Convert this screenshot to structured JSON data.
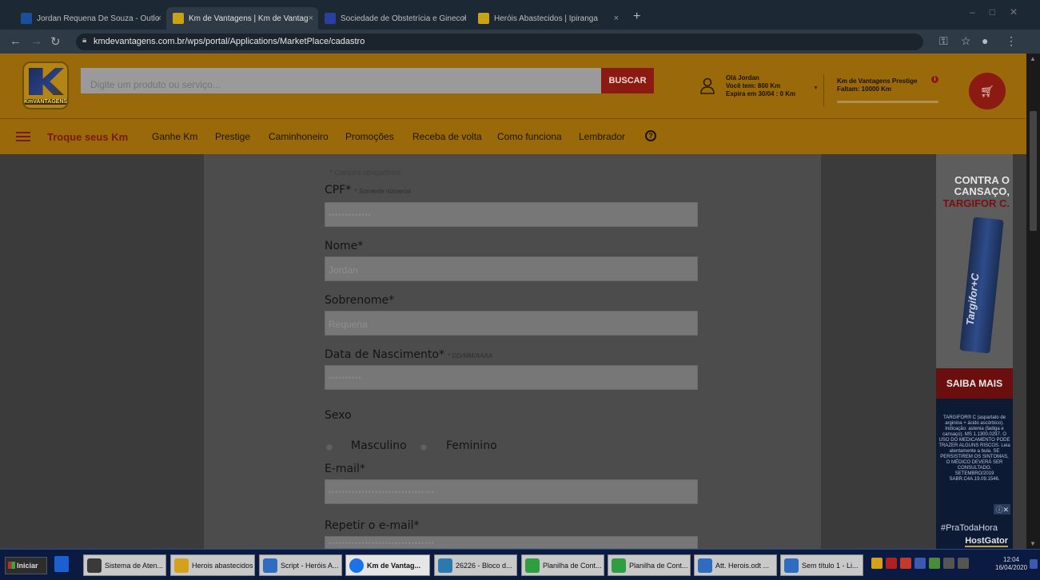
{
  "browser": {
    "tabs": [
      {
        "label": "Jordan Requena De Souza - Outlo",
        "favicon_color": "#1b4f9c",
        "active": false
      },
      {
        "label": "Km de Vantagens | Km de Vantag",
        "favicon_color": "#c8a318",
        "active": true
      },
      {
        "label": "Sociedade de Obstetrícia e Ginecol",
        "favicon_color": "#2b3fa0",
        "active": false
      },
      {
        "label": "Heróis Abastecidos | Ipiranga",
        "favicon_color": "#c8a318",
        "active": false
      }
    ],
    "tab_close": "×",
    "new_tab": "+",
    "url": "kmdevantagens.com.br/wps/portal/Applications/MarketPlace/cadastro"
  },
  "header": {
    "logo_text": "KmVANTAGENS",
    "search": {
      "placeholder": "Digite um produto ou serviço...",
      "button": "BUSCAR"
    },
    "user": {
      "greeting": "Olá Jordan",
      "balance": "Você tem: 800 Km",
      "expiry": "Expira em 30/04 : 0 Km"
    },
    "prestige": {
      "title": "Km de Vantagens Prestige",
      "remaining": "Faltam: 10000 Km",
      "progress": 0
    }
  },
  "nav": {
    "menu_label": "Troque seus Km",
    "items": [
      "Ganhe Km",
      "Prestige",
      "Caminhoneiro",
      "Promoções",
      "Receba de volta",
      "Como funciona",
      "Lembrador"
    ],
    "help": "?"
  },
  "form": {
    "required_note": "* Campos obrigatórios",
    "cpf": {
      "label": "CPF*",
      "note": "* Somente números",
      "value": "•••••••••••••"
    },
    "nome": {
      "label": "Nome*",
      "value": "Jordan"
    },
    "sobrenome": {
      "label": "Sobrenome*",
      "value": "Requena"
    },
    "nascimento": {
      "label": "Data de Nascimento*",
      "note": "* DD/MM/AAAA",
      "value": "••••••••••"
    },
    "sexo": {
      "label": "Sexo",
      "options": [
        "Masculino",
        "Feminino"
      ],
      "selected": "Masculino"
    },
    "email": {
      "label": "E-mail*",
      "value": "••••••••••••••••••••••••••••••••"
    },
    "email_confirm": {
      "label": "Repetir o e-mail*",
      "value": "••••••••••••••••••••••••••••••••"
    }
  },
  "ad": {
    "headline_1": "CONTRA O",
    "headline_2": "CANSAÇO,",
    "headline_3": "TARGIFOR C.",
    "product": "Targifor+C",
    "cta": "SAIBA MAIS",
    "fine_print": "TARGIFOR® C (aspartato de arginina + ácido ascórbico). Indicação: astenia (fadiga e cansaço). MS 1.1300.0297. O USO DO MEDICAMENTO PODE TRAZER ALGUNS RISCOS. Leia atentamente a bula. SE PERSISTIREM OS SINTOMAS, O MÉDICO DEVERÁ SER CONSULTADO. SETEMBRO/2019 SABR.C4A.19.09.1546.",
    "ad_choice": "ⓘ✕",
    "hashtag": "#PraTodaHora",
    "sponsor": "HostGator"
  },
  "taskbar": {
    "start": "Iniciar",
    "buttons": [
      {
        "label": "Sistema de Aten...",
        "color": "#3a3a3a"
      },
      {
        "label": "Herois abastecidos",
        "color": "#d4a21a"
      },
      {
        "label": "Script - Heróis A...",
        "color": "#2d6cc0"
      },
      {
        "label": "Km de Vantag...",
        "color": "#1a73e8",
        "active": true
      },
      {
        "label": "26226 - Bloco d...",
        "color": "#2a7ab0"
      },
      {
        "label": "Planilha de Cont...",
        "color": "#2e9e3e"
      },
      {
        "label": "Planilha de Cont...",
        "color": "#2e9e3e"
      },
      {
        "label": "Att. Herois.odt ...",
        "color": "#2d6cc0"
      },
      {
        "label": "Sem título 1 - Li...",
        "color": "#2d6cc0"
      }
    ],
    "time": "12:04",
    "date": "16/04/2020"
  }
}
